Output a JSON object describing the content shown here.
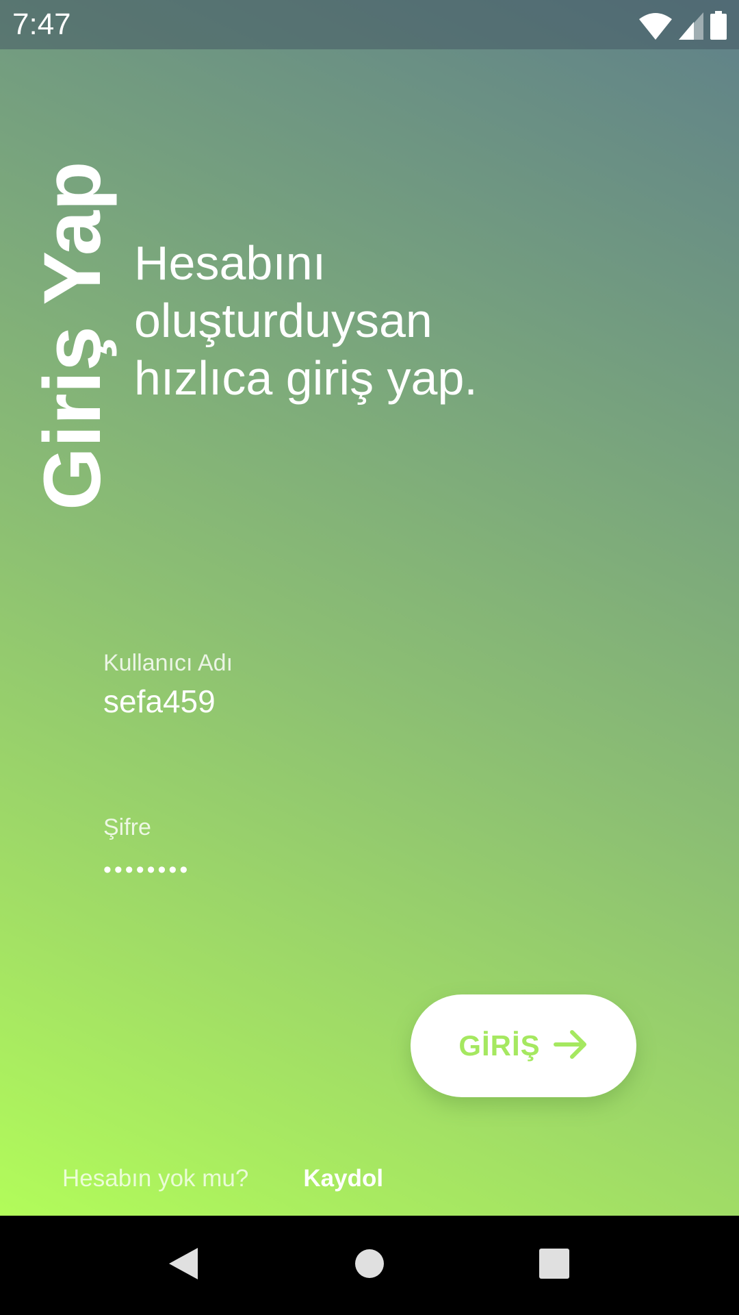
{
  "status_bar": {
    "time": "7:47",
    "icons": [
      "wifi-icon",
      "cellular-signal-icon",
      "battery-icon"
    ]
  },
  "screen": {
    "vertical_title": "Giriş Yap",
    "headline": "Hesabını\noluşturduysan\nhızlıca giriş yap."
  },
  "form": {
    "username": {
      "label": "Kullanıcı Adı",
      "value": "sefa459"
    },
    "password": {
      "label": "Şifre",
      "value": "••••••••"
    }
  },
  "login_button": {
    "label": "GİRİŞ",
    "icon": "arrow-right-icon"
  },
  "footer": {
    "prompt": "Hesabın yok mu?",
    "signup_link": "Kaydol"
  },
  "nav_bar": {
    "icons": [
      "back-icon",
      "home-icon",
      "recents-icon"
    ]
  },
  "colors": {
    "accent": "#a5e860",
    "gradient_top": "#5f8089",
    "gradient_bottom": "#b2fc5a"
  }
}
